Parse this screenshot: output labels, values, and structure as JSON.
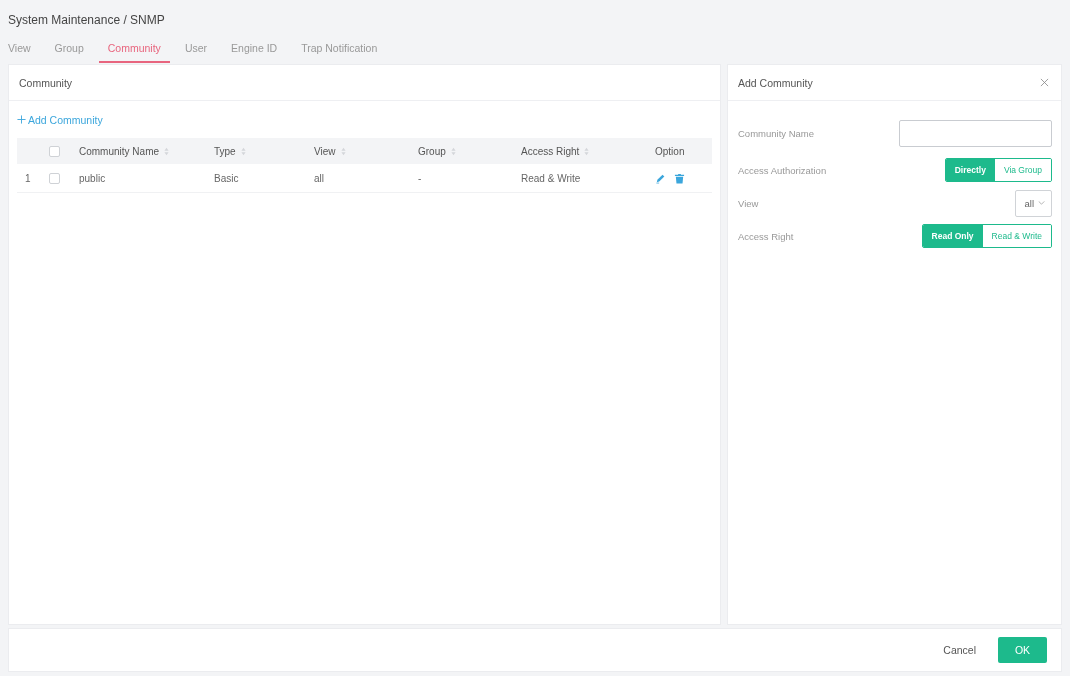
{
  "breadcrumb": "System Maintenance / SNMP",
  "tabs": [
    {
      "label": "View",
      "selected": false
    },
    {
      "label": "Group",
      "selected": false
    },
    {
      "label": "Community",
      "selected": true
    },
    {
      "label": "User",
      "selected": false
    },
    {
      "label": "Engine ID",
      "selected": false
    },
    {
      "label": "Trap Notification",
      "selected": false
    }
  ],
  "community_panel": {
    "title": "Community",
    "add_link": "Add Community"
  },
  "table": {
    "all_checked": false,
    "columns": [
      {
        "label": "Community Name",
        "sortable": true
      },
      {
        "label": "Type",
        "sortable": true
      },
      {
        "label": "View",
        "sortable": true
      },
      {
        "label": "Group",
        "sortable": true
      },
      {
        "label": "Access Right",
        "sortable": true
      },
      {
        "label": "Option",
        "sortable": false
      }
    ],
    "rows": [
      {
        "index": "1",
        "checked": false,
        "cells": [
          "public",
          "Basic",
          "all",
          "-",
          "Read & Write"
        ]
      }
    ]
  },
  "add_panel": {
    "title": "Add Community",
    "fields": [
      {
        "kind": "text",
        "label": "Community Name"
      },
      {
        "kind": "segmented",
        "label": "Access Authorization",
        "options": [
          {
            "label": "Directly",
            "selected": true
          },
          {
            "label": "Via Group",
            "selected": false
          }
        ]
      },
      {
        "kind": "select",
        "label": "View",
        "value": "all"
      },
      {
        "kind": "segmented",
        "label": "Access Right",
        "options": [
          {
            "label": "Read Only",
            "selected": true
          },
          {
            "label": "Read & Write",
            "selected": false
          }
        ]
      }
    ]
  },
  "footer": {
    "buttons": [
      {
        "kind": "plain",
        "label": "Cancel"
      },
      {
        "kind": "primary",
        "label": "OK"
      }
    ]
  }
}
